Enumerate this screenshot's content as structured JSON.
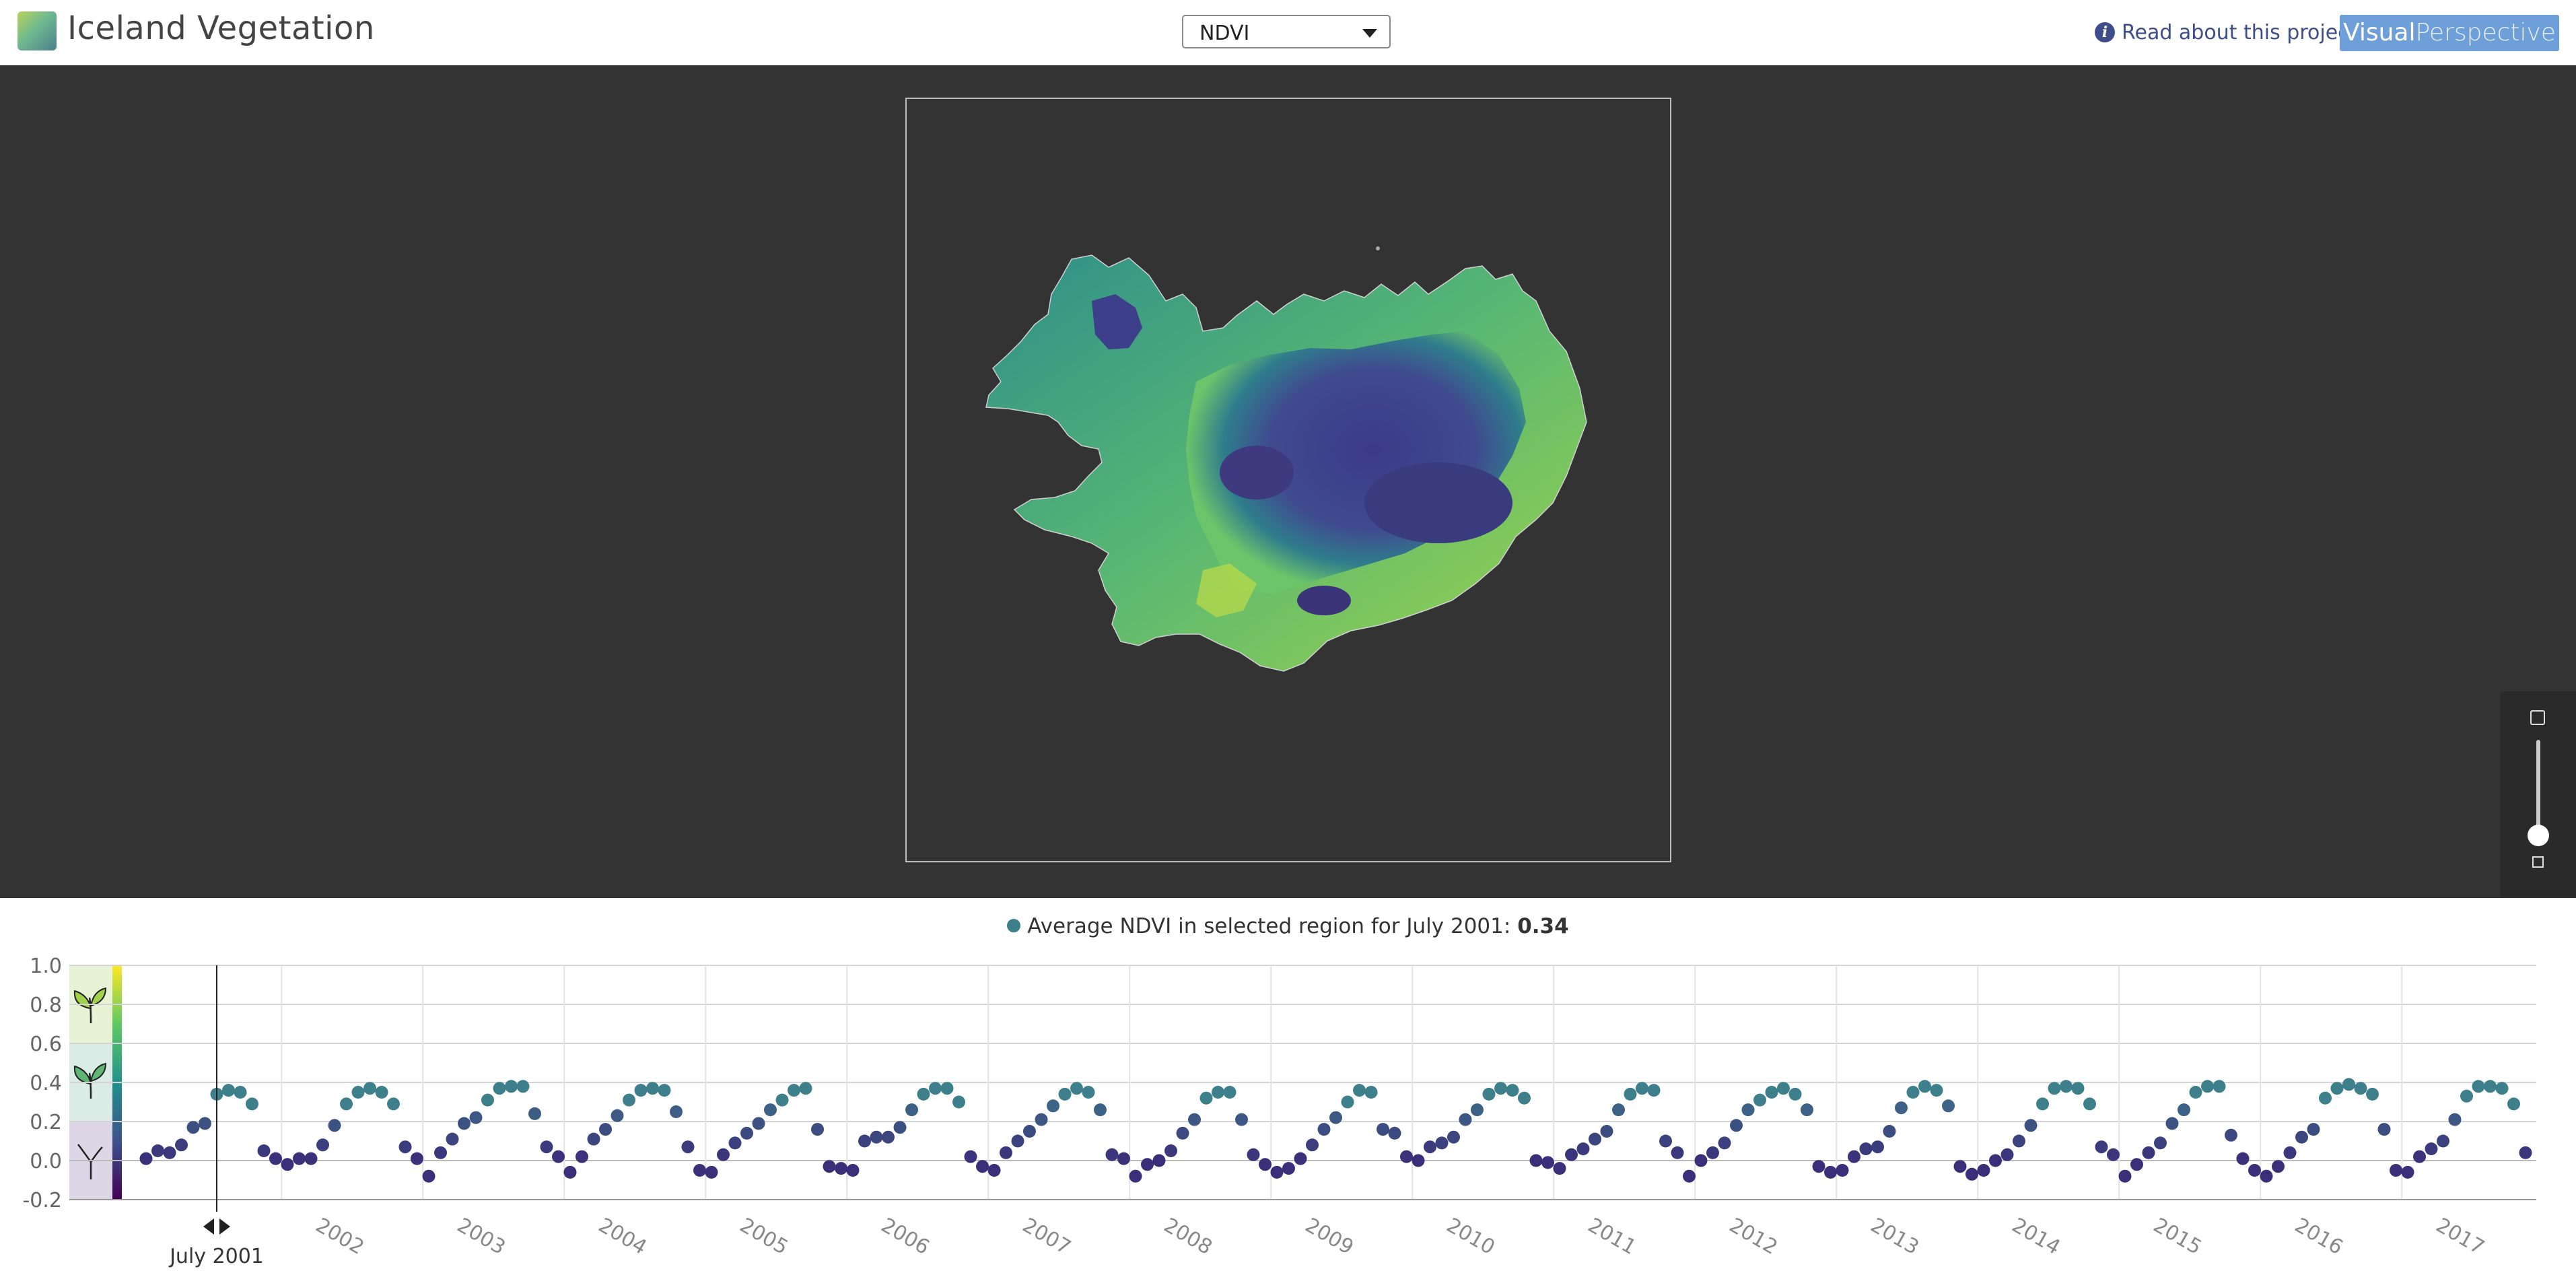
{
  "header": {
    "app_title": "Iceland Vegetation",
    "layer_select": {
      "value": "NDVI"
    },
    "about_link": "Read about this project",
    "brand": {
      "bold": "Visual",
      "light": "Perspective"
    }
  },
  "map": {
    "layer": "NDVI",
    "colormap": "viridis",
    "zoom_level_fraction": 0.2
  },
  "summary": {
    "prefix": "Average NDVI in selected region for ",
    "month": "July 2001",
    "separator": ": ",
    "value": "0.34"
  },
  "timeline_cursor_label": "July 2001",
  "colors": {
    "background_dark": "#333333",
    "accent_blue": "#6f9fd8",
    "link": "#3d4e8a",
    "dot_low": "#3b2f7a",
    "dot_high": "#3e7f8c"
  },
  "chart_data": {
    "type": "scatter",
    "xlabel": "",
    "ylabel": "",
    "ylim": [
      -0.2,
      1.0
    ],
    "y_ticks": [
      "1.0",
      "0.8",
      "0.6",
      "0.4",
      "0.2",
      "0.0",
      "-0.2"
    ],
    "x_start": "2001-01",
    "x_ticks": [
      "2002",
      "2003",
      "2004",
      "2005",
      "2006",
      "2007",
      "2008",
      "2009",
      "2010",
      "2011",
      "2012",
      "2013",
      "2014",
      "2015",
      "2016",
      "2017"
    ],
    "grid": true,
    "legend": "none",
    "selected_month": "2001-07",
    "monthly_pattern": [
      0.0,
      0.05,
      0.05,
      0.08,
      0.17,
      0.19,
      0.34,
      0.36,
      0.35,
      0.29,
      0.06,
      0.0
    ],
    "series": [
      {
        "year": "2001",
        "values": [
          0.01,
          0.05,
          0.04,
          0.08,
          0.17,
          0.19,
          0.34,
          0.36,
          0.35,
          0.29,
          0.05,
          0.01
        ]
      },
      {
        "year": "2002",
        "values": [
          -0.02,
          0.01,
          0.01,
          0.08,
          0.18,
          0.29,
          0.35,
          0.37,
          0.35,
          0.29,
          0.07,
          0.01
        ]
      },
      {
        "year": "2003",
        "values": [
          -0.08,
          0.04,
          0.11,
          0.19,
          0.22,
          0.31,
          0.37,
          0.38,
          0.38,
          0.24,
          0.07,
          0.02
        ]
      },
      {
        "year": "2004",
        "values": [
          -0.06,
          0.02,
          0.11,
          0.16,
          0.23,
          0.31,
          0.36,
          0.37,
          0.36,
          0.25,
          0.07,
          -0.05
        ]
      },
      {
        "year": "2005",
        "values": [
          -0.06,
          0.03,
          0.09,
          0.14,
          0.19,
          0.26,
          0.31,
          0.36,
          0.37,
          0.16,
          -0.03,
          -0.04
        ]
      },
      {
        "year": "2006",
        "values": [
          -0.05,
          0.1,
          0.12,
          0.12,
          0.17,
          0.26,
          0.34,
          0.37,
          0.37,
          0.3,
          0.02,
          -0.03
        ]
      },
      {
        "year": "2007",
        "values": [
          -0.05,
          0.04,
          0.1,
          0.15,
          0.21,
          0.28,
          0.34,
          0.37,
          0.35,
          0.26,
          0.03,
          0.01
        ]
      },
      {
        "year": "2008",
        "values": [
          -0.08,
          -0.02,
          0.0,
          0.05,
          0.14,
          0.21,
          0.32,
          0.35,
          0.35,
          0.21,
          0.03,
          -0.02
        ]
      },
      {
        "year": "2009",
        "values": [
          -0.06,
          -0.04,
          0.01,
          0.08,
          0.16,
          0.22,
          0.3,
          0.36,
          0.35,
          0.16,
          0.14,
          0.02
        ]
      },
      {
        "year": "2010",
        "values": [
          0.0,
          0.07,
          0.09,
          0.12,
          0.21,
          0.26,
          0.34,
          0.37,
          0.36,
          0.32,
          0.0,
          -0.01
        ]
      },
      {
        "year": "2011",
        "values": [
          -0.04,
          0.03,
          0.06,
          0.11,
          0.15,
          0.26,
          0.34,
          0.37,
          0.36,
          0.1,
          0.04,
          -0.08
        ]
      },
      {
        "year": "2012",
        "values": [
          0.0,
          0.04,
          0.09,
          0.18,
          0.26,
          0.31,
          0.35,
          0.37,
          0.34,
          0.26,
          -0.03,
          -0.06
        ]
      },
      {
        "year": "2013",
        "values": [
          -0.05,
          0.02,
          0.06,
          0.07,
          0.15,
          0.27,
          0.35,
          0.38,
          0.36,
          0.28,
          -0.03,
          -0.07
        ]
      },
      {
        "year": "2014",
        "values": [
          -0.05,
          0.0,
          0.03,
          0.1,
          0.18,
          0.29,
          0.37,
          0.38,
          0.37,
          0.29,
          0.07,
          0.03
        ]
      },
      {
        "year": "2015",
        "values": [
          -0.08,
          -0.02,
          0.04,
          0.09,
          0.19,
          0.26,
          0.35,
          0.38,
          0.38,
          0.13,
          0.01,
          -0.05
        ]
      },
      {
        "year": "2016",
        "values": [
          -0.08,
          -0.03,
          0.04,
          0.12,
          0.16,
          0.32,
          0.37,
          0.39,
          0.37,
          0.34,
          0.16,
          -0.05
        ]
      },
      {
        "year": "2017",
        "values": [
          -0.06,
          0.02,
          0.06,
          0.1,
          0.21,
          0.33,
          0.38,
          0.38,
          0.37,
          0.29,
          0.04,
          -0.08
        ]
      }
    ]
  }
}
